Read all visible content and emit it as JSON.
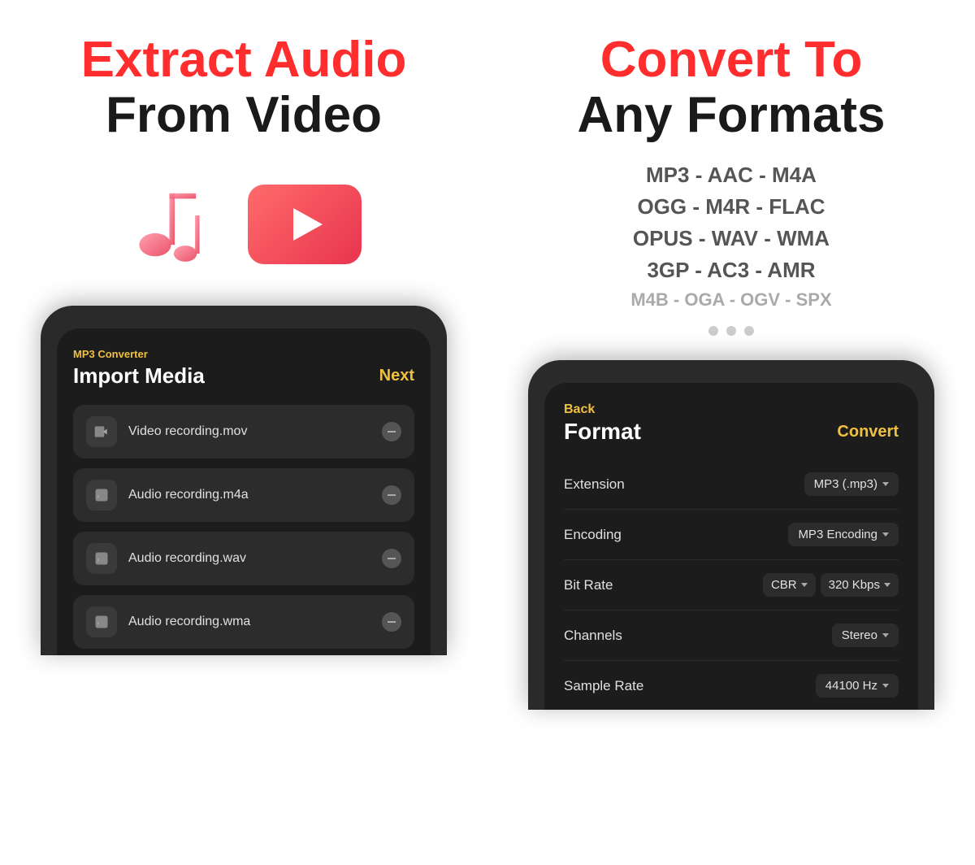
{
  "left": {
    "headline_red": "Extract Audio",
    "headline_black": "From Video",
    "phone": {
      "app_label": "MP3 Converter",
      "title": "Import Media",
      "next_btn": "Next",
      "files": [
        {
          "name": "Video recording.mov",
          "type": "video"
        },
        {
          "name": "Audio recording.m4a",
          "type": "audio"
        },
        {
          "name": "Audio recording.wav",
          "type": "audio"
        },
        {
          "name": "Audio recording.wma",
          "type": "audio"
        }
      ]
    }
  },
  "right": {
    "headline_red": "Convert To",
    "headline_black": "Any Formats",
    "formats": [
      "MP3 - AAC - M4A",
      "OGG - M4R - FLAC",
      "OPUS - WAV - WMA",
      "3GP - AC3 - AMR",
      "M4B - OGA - OGV - SPX"
    ],
    "phone": {
      "back_label": "Back",
      "title": "Format",
      "convert_btn": "Convert",
      "settings": [
        {
          "label": "Extension",
          "values": [
            "MP3 (.mp3)"
          ]
        },
        {
          "label": "Encoding",
          "values": [
            "MP3 Encoding"
          ]
        },
        {
          "label": "Bit Rate",
          "values": [
            "CBR",
            "320 Kbps"
          ]
        },
        {
          "label": "Channels",
          "values": [
            "Stereo"
          ]
        },
        {
          "label": "Sample Rate",
          "values": [
            "44100 Hz"
          ]
        }
      ]
    }
  },
  "dots": [
    "dot1",
    "dot2",
    "dot3"
  ]
}
